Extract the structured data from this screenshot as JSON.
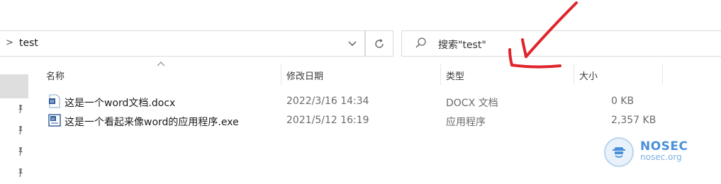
{
  "address_bar": {
    "path_text": "test",
    "chevron": ">",
    "dropdown_icon": "chevron-down-icon",
    "refresh_icon": "refresh-icon"
  },
  "search": {
    "placeholder": "搜索\"test\"",
    "icon": "search-icon"
  },
  "columns": {
    "name": "名称",
    "modified": "修改日期",
    "type": "类型",
    "size": "大小"
  },
  "files": [
    {
      "name": "这是一个word文档.docx",
      "modified": "2022/3/16 14:34",
      "type": "DOCX 文档",
      "size": "0 KB",
      "icon": "word-document-icon"
    },
    {
      "name": "这是一个看起来像word的应用程序.exe",
      "modified": "2021/5/12 16:19",
      "type": "应用程序",
      "size": "2,357 KB",
      "icon": "word-lookalike-exe-icon"
    }
  ],
  "watermark": {
    "title": "NOSEC",
    "subtitle": "nosec.org"
  },
  "colors": {
    "annotation_red": "#e0242a",
    "watermark_blue": "#4a90d9",
    "selection_gray": "#dedede"
  }
}
